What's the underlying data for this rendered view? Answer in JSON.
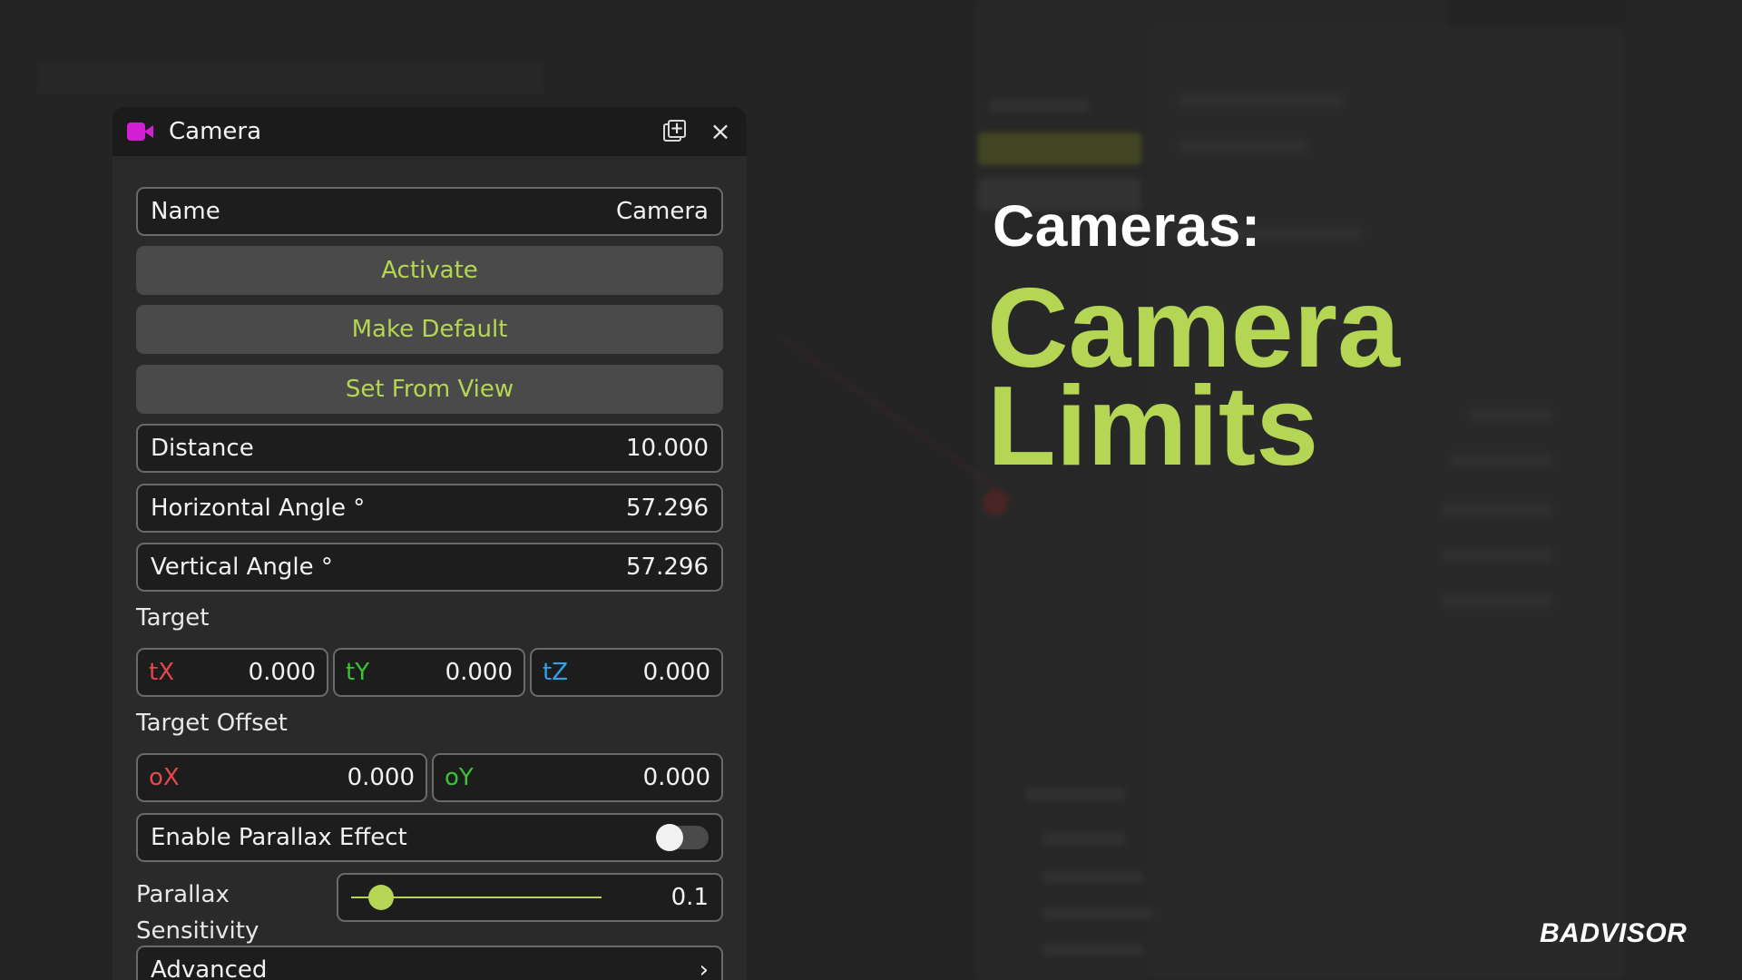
{
  "panel": {
    "title": "Camera",
    "icon": "camera-icon",
    "duplicate_icon": "duplicate-icon",
    "close_icon": "×",
    "fields": {
      "name_label": "Name",
      "name_value": "Camera",
      "distance_label": "Distance",
      "distance_value": "10.000",
      "hangle_label": "Horizontal Angle °",
      "hangle_value": "57.296",
      "vangle_label": "Vertical Angle °",
      "vangle_value": "57.296"
    },
    "buttons": {
      "activate": "Activate",
      "make_default": "Make Default",
      "set_from_view": "Set From View"
    },
    "target": {
      "label": "Target",
      "tx_label": "tX",
      "tx_value": "0.000",
      "ty_label": "tY",
      "ty_value": "0.000",
      "tz_label": "tZ",
      "tz_value": "0.000"
    },
    "target_offset": {
      "label": "Target Offset",
      "ox_label": "oX",
      "ox_value": "0.000",
      "oy_label": "oY",
      "oy_value": "0.000"
    },
    "parallax": {
      "enable_label": "Enable Parallax Effect",
      "enabled": false,
      "sensitivity_label_1": "Parallax",
      "sensitivity_label_2": "Sensitivity",
      "sensitivity_value": "0.1",
      "sensitivity_fraction": 0.12
    },
    "advanced_label": "Advanced",
    "advanced_chevron": "›"
  },
  "overlay": {
    "subtitle": "Cameras:",
    "headline_line1": "Camera",
    "headline_line2": "Limits",
    "brand": "BADVISOR"
  },
  "colors": {
    "accent": "#b4d654",
    "camera_icon": "#d41fd4",
    "axis_x": "#e5484d",
    "axis_y": "#39c434",
    "axis_z": "#2ea3e8"
  }
}
